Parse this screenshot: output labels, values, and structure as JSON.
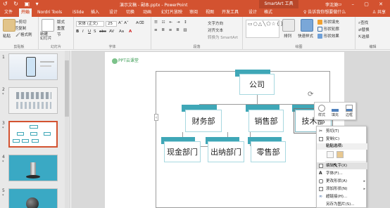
{
  "titlebar": {
    "quick_access": "↺ ↻ ▣ ▾",
    "doc_title": "演示文稿 - 副本.pptx - PowerPoint",
    "context_tab_group": "SmartArt 工具",
    "user": "李沈美",
    "window_controls": "▭ – ▢ ✕"
  },
  "tabs": [
    {
      "label": "文件",
      "active": false
    },
    {
      "label": "开始",
      "active": true
    },
    {
      "label": "Nordri Tools",
      "active": false
    },
    {
      "label": "iSlide",
      "active": false
    },
    {
      "label": "插入",
      "active": false
    },
    {
      "label": "设计",
      "active": false
    },
    {
      "label": "切换",
      "active": false
    },
    {
      "label": "动画",
      "active": false
    },
    {
      "label": "幻灯片放映",
      "active": false
    },
    {
      "label": "审阅",
      "active": false
    },
    {
      "label": "视图",
      "active": false
    },
    {
      "label": "开发工具",
      "active": false
    },
    {
      "label": "设计",
      "active": false
    },
    {
      "label": "格式",
      "active": false
    }
  ],
  "tell_me": "♀ 告诉我你想要做什么",
  "share": "♙ 共享",
  "ribbon": {
    "clipboard": {
      "label": "剪贴板",
      "paste": "粘贴",
      "cut": "剪切",
      "copy": "复制",
      "format_painter": "格式刷"
    },
    "slides": {
      "label": "幻灯片",
      "new_slide": "新建\n幻灯片",
      "layout": "版式",
      "reset": "重置",
      "section": "节"
    },
    "font": {
      "label": "字体",
      "font_name": "宋体 (正文)",
      "font_size": "25",
      "buttons": [
        "B",
        "I",
        "U",
        "S",
        "abc",
        "AV",
        "Aa",
        "A"
      ]
    },
    "paragraph": {
      "label": "段落",
      "text_direction": "文字方向",
      "align_text": "对齐文本",
      "convert_smartart": "转换为 SmartArt"
    },
    "drawing": {
      "label": "绘图",
      "arrange": "排列",
      "quick_styles": "快速样式",
      "shape_fill": "形状填充",
      "shape_outline": "形状轮廓",
      "shape_effects": "形状效果"
    },
    "editing": {
      "label": "编辑",
      "find": "查找",
      "replace": "替换",
      "select": "选择"
    }
  },
  "slides": [
    {
      "number": "1",
      "star": ""
    },
    {
      "number": "2",
      "star": "*"
    },
    {
      "number": "3",
      "star": "*"
    },
    {
      "number": "4",
      "star": "*"
    },
    {
      "number": "5",
      "star": "*"
    }
  ],
  "slide": {
    "logo_text": "PPT云课堂",
    "nodes": {
      "root": "公司",
      "finance": "财务部",
      "sales": "销售部",
      "tech": "技术部",
      "cash": "现金部门",
      "cashier": "出纳部门",
      "retail": "零售部"
    }
  },
  "mini_toolbar": {
    "style": "样式",
    "fill": "填充",
    "outline": "边框"
  },
  "context_menu": [
    {
      "label": "剪切(T)",
      "type": "item"
    },
    {
      "label": "复制(C)",
      "type": "item"
    },
    {
      "label": "粘贴选项:",
      "type": "header"
    },
    {
      "label": "",
      "type": "paste"
    },
    {
      "label": "编辑文字(X)",
      "type": "item",
      "highlighted": true
    },
    {
      "label": "字体(F)...",
      "type": "item"
    },
    {
      "label": "更改形状(A)",
      "type": "item",
      "submenu": true
    },
    {
      "label": "添加形状(N)",
      "type": "item",
      "submenu": true
    },
    {
      "label": "超链接(H)...",
      "type": "item"
    },
    {
      "label": "另存为图片(S)...",
      "type": "item"
    }
  ],
  "colors": {
    "accent": "#d35230",
    "node_tab": "#3fa7b7",
    "node_border": "#a8d8e0"
  }
}
